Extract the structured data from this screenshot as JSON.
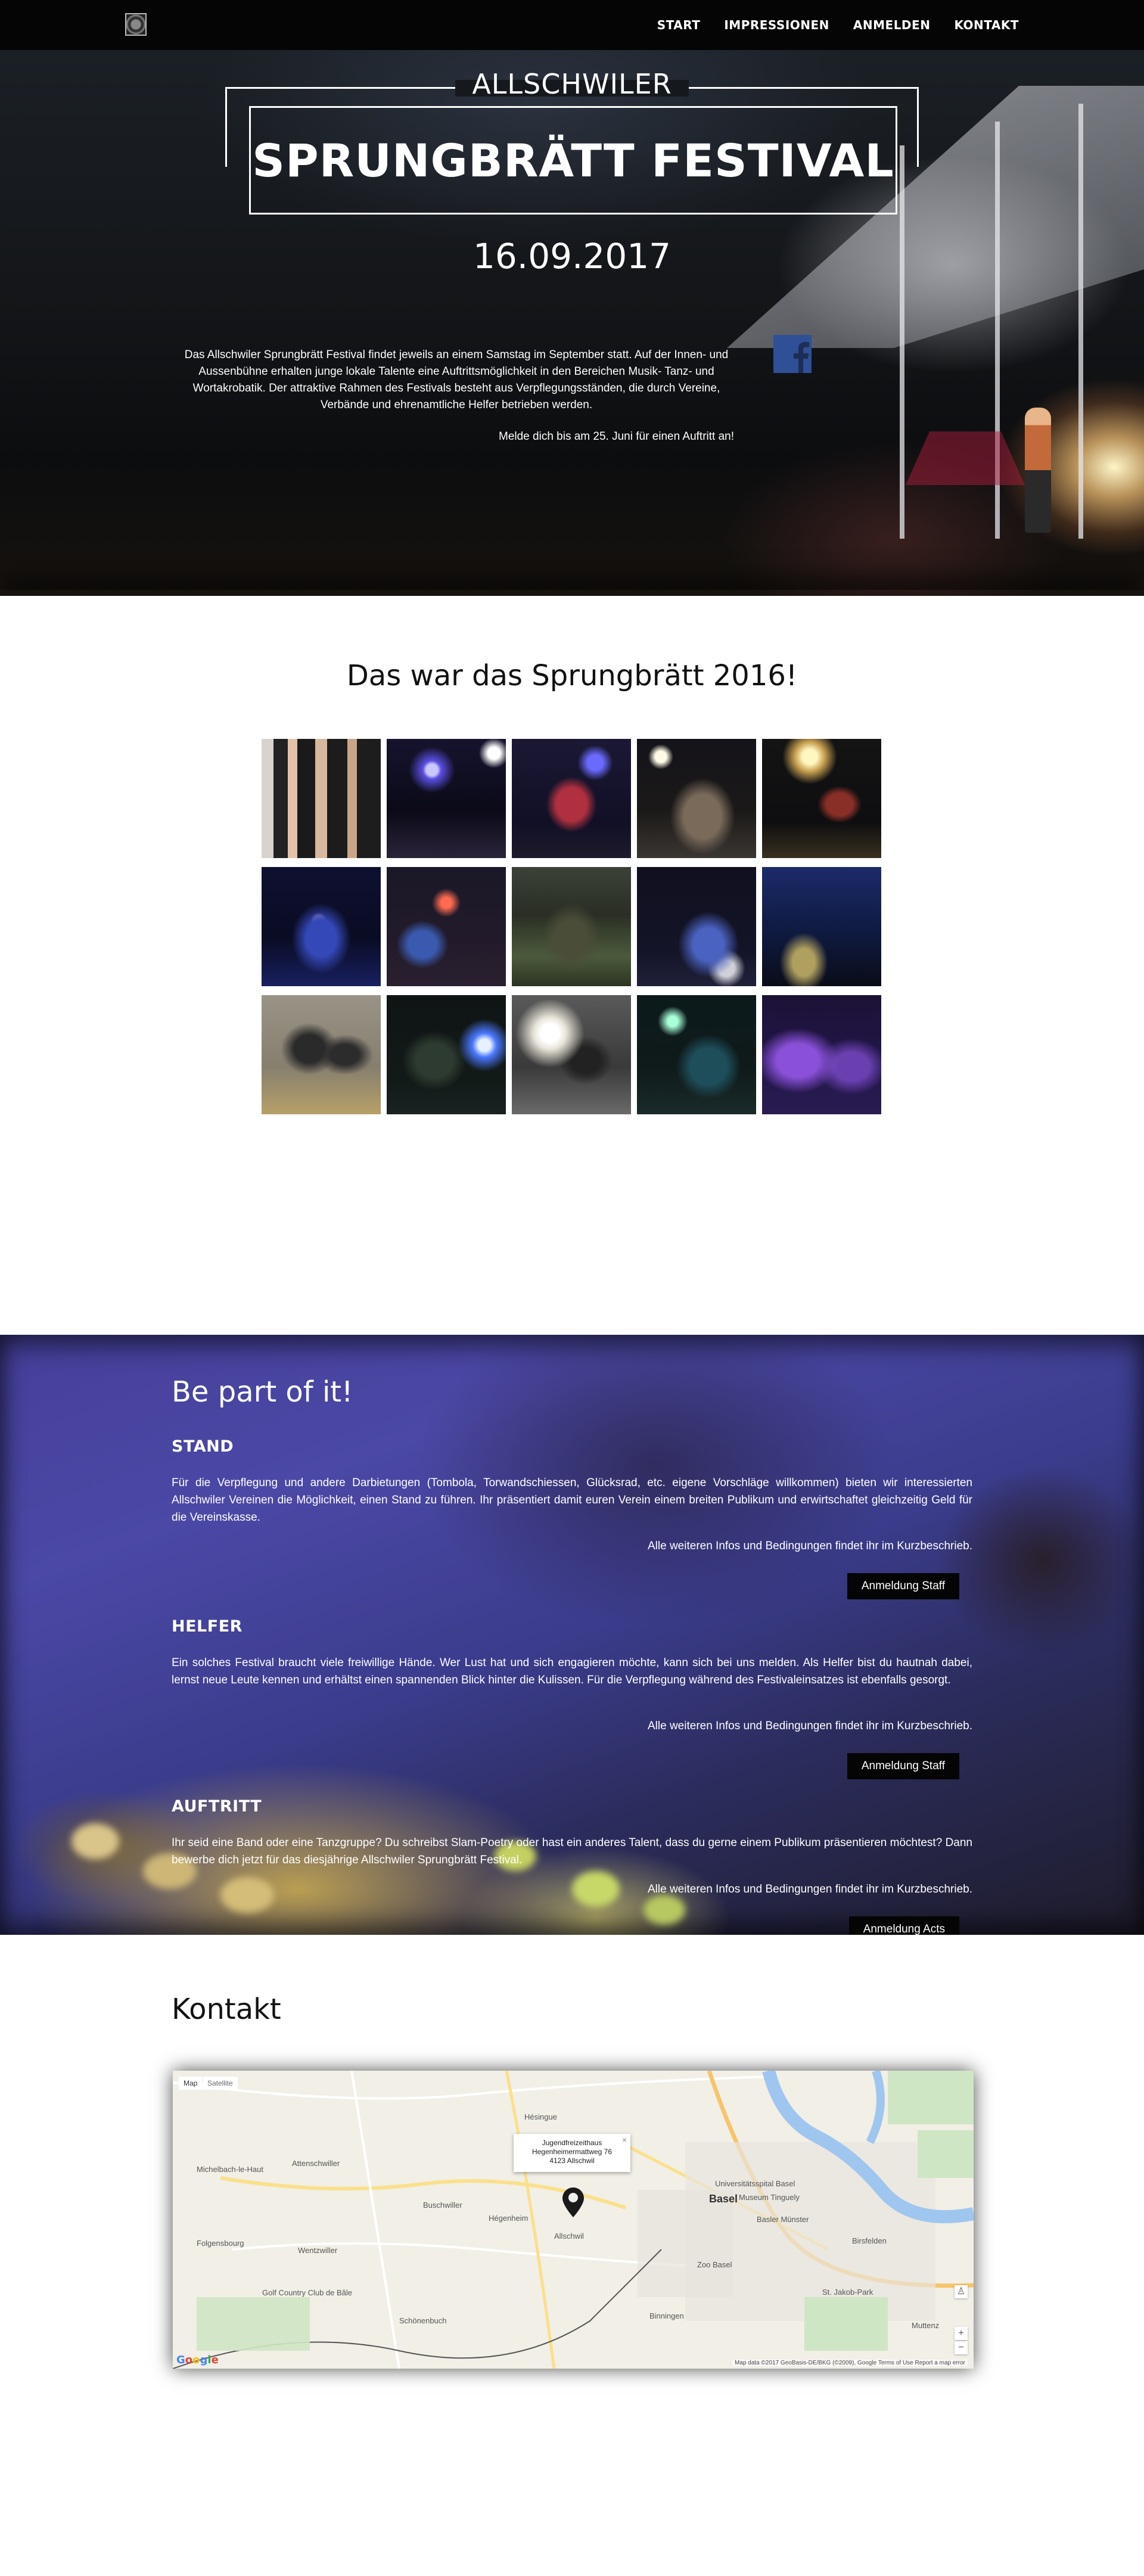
{
  "nav": {
    "items": [
      "START",
      "IMPRESSIONEN",
      "ANMELDEN",
      "KONTAKT"
    ]
  },
  "hero": {
    "top_label": "ALLSCHWILER",
    "title": "SPRUNGBRÄTT FESTIVAL",
    "date": "16.09.2017",
    "text": "Das Allschwiler Sprungbrätt Festival findet jeweils an einem Samstag im September statt. Auf der Innen- und Aussenbühne erhalten junge lokale Talente eine Auftrittsmöglichkeit in den Bereichen Musik- Tanz- und Wortakrobatik. Der attraktive Rahmen des Festivals besteht aus Verpflegungsständen, die durch Vereine, Verbände und ehrenamtliche Helfer betrieben werden.",
    "cta": "Melde dich bis am 25. Juni für einen Auftritt an!",
    "facebook_icon": "facebook-icon",
    "facebook_color": "#2f4f96"
  },
  "impressions": {
    "title": "Das war das Sprungbrätt 2016!",
    "photo_count": 15
  },
  "part": {
    "title": "Be part of it!",
    "sections": [
      {
        "heading": "STAND",
        "text": "Für die Verpflegung und andere Darbietungen (Tombola, Torwandschiessen, Glücksrad, etc. eigene Vorschläge willkommen) bieten wir interessierten Allschwiler Vereinen die Möglichkeit, einen Stand zu führen. Ihr präsentiert damit euren Verein einem breiten Publikum und erwirtschaftet gleichzeitig Geld für die Vereinskasse.",
        "info": "Alle weiteren Infos und Bedingungen findet ihr im Kurzbeschrieb.",
        "button": "Anmeldung Staff"
      },
      {
        "heading": "HELFER",
        "text": "Ein solches Festival braucht viele freiwillige Hände. Wer Lust hat und sich engagieren möchte, kann sich bei uns melden. Als Helfer bist du hautnah dabei, lernst neue Leute kennen und erhältst einen spannenden Blick hinter die Kulissen. Für die Verpflegung während des Festivaleinsatzes ist ebenfalls gesorgt.",
        "info": "Alle weiteren Infos und Bedingungen findet ihr im Kurzbeschrieb.",
        "button": "Anmeldung Staff"
      },
      {
        "heading": "AUFTRITT",
        "text": "Ihr seid eine Band oder eine Tanzgruppe? Du schreibst Slam-Poetry oder hast ein anderes Talent, dass du gerne einem Publikum präsentieren möchtest? Dann bewerbe dich jetzt für das diesjährige Allschwiler Sprungbrätt Festival.",
        "info": "Alle weiteren Infos und Bedingungen findet ihr im Kurzbeschrieb.",
        "button": "Anmeldung Acts"
      }
    ]
  },
  "kontakt": {
    "title": "Kontakt",
    "map": {
      "tab_map": "Map",
      "tab_satellite": "Satellite",
      "popup_line1": "Jugendfreizeithaus",
      "popup_line2": "Hegenheimermattweg 76",
      "popup_line3": "4123 Allschwil",
      "labels": {
        "hegenheim": "Hégenheim",
        "allschwil": "Allschwil",
        "basel": "Basel",
        "binningen": "Binningen",
        "birsfelden": "Birsfelden",
        "muttenz": "Muttenz",
        "schoenenbuch": "Schönenbuch",
        "buschwiller": "Buschwiller",
        "folgensbourg": "Folgensbourg",
        "wentzwiller": "Wentzwiller",
        "attenschwiller": "Attenschwiller",
        "michelbach": "Michelbach-le-Haut",
        "hesingue": "Hésingue",
        "zoo": "Zoo Basel",
        "jakob": "St. Jakob-Park",
        "museum": "Museum Tinguely",
        "unispital": "Universitätsspital Basel",
        "muenster": "Basler Münster",
        "golf": "Golf Country Club de Bâle"
      },
      "google": "Google",
      "footer": "Map data ©2017 GeoBasis-DE/BKG (©2009), Google   Terms of Use   Report a map error"
    }
  }
}
